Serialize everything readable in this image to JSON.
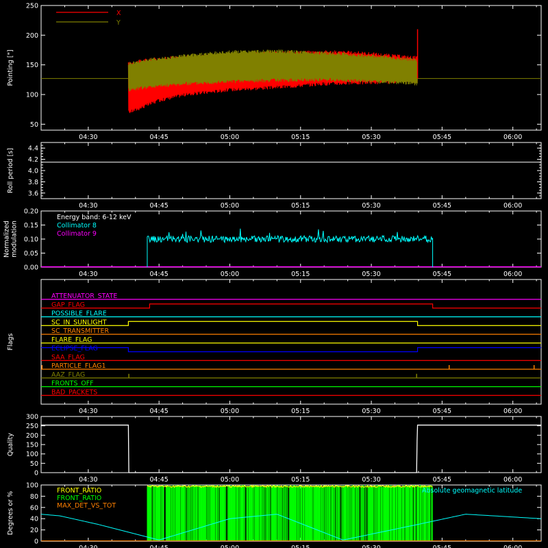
{
  "colors": {
    "background": "#000000",
    "axes": "#ffffff",
    "x_series": "#ff0000",
    "y_series": "#808000",
    "collimator8": "#00ffff",
    "collimator9": "#ff00ff",
    "front_ratio_a": "#ffff00",
    "front_ratio_b": "#00ff00",
    "max_det": "#ff8000",
    "geomag": "#00ffff"
  },
  "time_axis": {
    "start_minutes": 260,
    "end_minutes": 366,
    "tick_labels": [
      "04:30",
      "04:45",
      "05:00",
      "05:15",
      "05:30",
      "05:45",
      "06:00"
    ],
    "tick_minutes": [
      270,
      285,
      300,
      315,
      330,
      345,
      360
    ]
  },
  "chart_data": [
    {
      "panel": "pointing",
      "type": "line",
      "ylabel": "Pointing [\"]",
      "ylim": [
        40,
        250
      ],
      "yticks": [
        50,
        100,
        150,
        200,
        250
      ],
      "legend": [
        {
          "name": "X",
          "color": "#ff0000"
        },
        {
          "name": "Y",
          "color": "#808000"
        }
      ],
      "active_range": [
        278.5,
        339.8
      ],
      "series": [
        {
          "name": "X",
          "color": "#ff0000",
          "upper_envelope": {
            "x": [
              278.5,
              282,
              290,
              300,
              310,
              320,
              328,
              335,
              339.8
            ],
            "y": [
              152,
              158,
              163,
              166,
              170,
              172,
              170,
              165,
              162
            ]
          },
          "lower_envelope": {
            "x": [
              278.5,
              280,
              285,
              290,
              300,
              310,
              320,
              330,
              339.8
            ],
            "y": [
              70,
              74,
              90,
              99,
              108,
              112,
              118,
              120,
              122
            ]
          }
        },
        {
          "name": "Y",
          "color": "#808000",
          "upper_envelope": {
            "x": [
              278.5,
              282,
              290,
              300,
              310,
              320,
              330,
              339.8
            ],
            "y": [
              152,
              158,
              165,
              172,
              173,
              170,
              165,
              158
            ]
          },
          "lower_envelope": {
            "x": [
              278.5,
              282,
              290,
              300,
              310,
              320,
              330,
              339.8
            ],
            "y": [
              108,
              112,
              118,
              122,
              124,
              125,
              122,
              118
            ]
          }
        }
      ],
      "baseline": 127,
      "spike": {
        "x": 339.8,
        "y": 210
      }
    },
    {
      "panel": "roll",
      "type": "line",
      "ylabel": "Roll period [s]",
      "ylim": [
        3.5,
        4.5
      ],
      "yticks": [
        3.6,
        3.8,
        4.0,
        4.2,
        4.4
      ],
      "ytick_labels": [
        "3.6",
        "3.8",
        "4.0",
        "4.2",
        "4.4"
      ],
      "value": 4.15
    },
    {
      "panel": "modulation",
      "type": "line",
      "ylabel": [
        "Normalized",
        "modulation"
      ],
      "ylim": [
        0,
        0.2
      ],
      "yticks": [
        0,
        0.05,
        0.1,
        0.15,
        0.2
      ],
      "ytick_labels": [
        "0.00",
        "0.05",
        "0.10",
        "0.15",
        "0.20"
      ],
      "legend": [
        {
          "name": "Energy band: 6-12 keV",
          "color": "#ffffff"
        },
        {
          "name": "Collimator 8",
          "color": "#00ffff"
        },
        {
          "name": "Collimator 9",
          "color": "#ff00ff"
        }
      ],
      "collimator8": {
        "start": 282.5,
        "end": 343,
        "mean": 0.1,
        "spread": 0.012,
        "max": 0.15
      },
      "collimator9": {
        "value": 0
      }
    },
    {
      "panel": "flags",
      "type": "line",
      "ylabel": "Flags",
      "flags": [
        {
          "name": "ATTENUATOR_STATE",
          "color": "#ff00ff",
          "segments": [
            [
              260,
              366,
              0
            ]
          ]
        },
        {
          "name": "GAP_FLAG",
          "color": "#ff0000",
          "segments": [
            [
              260,
              283,
              0
            ],
            [
              283,
              343,
              1
            ],
            [
              343,
              366,
              0
            ]
          ]
        },
        {
          "name": "POSSIBLE_FLARE",
          "color": "#00ffff",
          "segments": [
            [
              260,
              366,
              0
            ]
          ]
        },
        {
          "name": "SC_IN_SUNLIGHT",
          "color": "#ffff00",
          "segments": [
            [
              260,
              278.5,
              0
            ],
            [
              278.5,
              339.8,
              1
            ],
            [
              339.8,
              366,
              0
            ]
          ]
        },
        {
          "name": "SC_TRANSMITTER",
          "color": "#ff8000",
          "segments": [
            [
              260,
              366,
              0
            ]
          ]
        },
        {
          "name": "FLARE_FLAG",
          "color": "#ffff00",
          "segments": [
            [
              260,
              366,
              0
            ]
          ]
        },
        {
          "name": "ECLIPSE_FLAG",
          "color": "#0000ff",
          "segments": [
            [
              260,
              278.5,
              1
            ],
            [
              278.5,
              339.8,
              0
            ],
            [
              339.8,
              366,
              1
            ]
          ]
        },
        {
          "name": "SAA_FLAG",
          "color": "#ff0000",
          "segments": [
            [
              260,
              366,
              0
            ]
          ]
        },
        {
          "name": "PARTICLE_FLAG1",
          "color": "#ff8000",
          "segments": [
            [
              260,
              366,
              0
            ]
          ],
          "spikes": [
            260.2,
            346.5,
            364.5
          ]
        },
        {
          "name": "AAZ_FLAG",
          "color": "#808000",
          "segments": [
            [
              260,
              366,
              0
            ]
          ],
          "spikes": [
            278.6,
            339.6
          ]
        },
        {
          "name": "FRONTS_OFF",
          "color": "#00ff00",
          "segments": [
            [
              260,
              366,
              0
            ]
          ]
        },
        {
          "name": "BAD_PACKETS",
          "color": "#ff0000",
          "segments": [
            [
              260,
              366,
              0
            ]
          ]
        }
      ]
    },
    {
      "panel": "quality",
      "type": "line",
      "ylabel": "Quality",
      "ylim": [
        0,
        300
      ],
      "yticks": [
        0,
        50,
        100,
        150,
        200,
        250,
        300
      ],
      "ytick_labels": [
        "0",
        "50",
        "100",
        "150",
        "200",
        "250",
        "300"
      ],
      "x": [
        260,
        278.5,
        278.6,
        339.6,
        339.7,
        339.8,
        366
      ],
      "y": [
        254,
        254,
        0,
        0,
        170,
        254,
        254
      ]
    },
    {
      "panel": "ratios",
      "type": "line",
      "ylabel": "Degrees or %",
      "ylim": [
        0,
        100
      ],
      "yticks": [
        0,
        20,
        40,
        60,
        80,
        100
      ],
      "ytick_labels": [
        "0",
        "20",
        "40",
        "60",
        "80",
        "100"
      ],
      "legend": [
        {
          "name": "FRONT_RATIO",
          "color": "#ffff00"
        },
        {
          "name": "FRONT_RATIO",
          "color": "#00ff00"
        },
        {
          "name": "MAX_DET_VS_TOT",
          "color": "#ff8000"
        }
      ],
      "geomag_label": "Absolute geomagnetic latitude",
      "geomag": {
        "x": [
          260,
          264,
          272,
          285,
          300,
          310,
          324,
          340,
          350,
          366
        ],
        "y": [
          48,
          45,
          30,
          2,
          40,
          48,
          2,
          30,
          48,
          40
        ]
      },
      "front_ratio_range": [
        282.5,
        343
      ],
      "front_ratio_top": 99
    }
  ]
}
